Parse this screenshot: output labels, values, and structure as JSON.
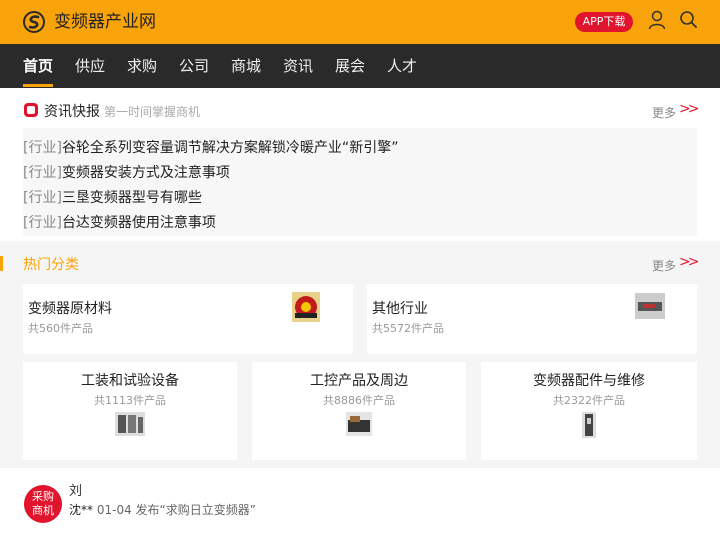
{
  "header": {
    "site_title": "变频器产业网",
    "app_button": "APP下载",
    "brand_color": "#f9a30b",
    "accent_color": "#e0142d",
    "icons": [
      "logo-icon",
      "user-icon",
      "search-icon"
    ]
  },
  "nav": {
    "items": [
      {
        "label": "首页",
        "active": true
      },
      {
        "label": "供应"
      },
      {
        "label": "求购"
      },
      {
        "label": "公司"
      },
      {
        "label": "商城"
      },
      {
        "label": "资讯"
      },
      {
        "label": "展会"
      },
      {
        "label": "人才"
      }
    ]
  },
  "news": {
    "title": "资讯快报",
    "subtitle": "第一时间掌握商机",
    "more": "更多",
    "items": [
      {
        "tag": "[行业]",
        "text": "谷轮全系列变容量调节解决方案解锁冷暖产业“新引擎”"
      },
      {
        "tag": "[行业]",
        "text": "变频器安装方式及注意事项"
      },
      {
        "tag": "[行业]",
        "text": "三垦变频器型号有哪些"
      },
      {
        "tag": "[行业]",
        "text": "台达变频器使用注意事项"
      }
    ]
  },
  "hot": {
    "title": "热门分类",
    "more": "更多",
    "categories": [
      {
        "name": "变频器原材料",
        "count": "共560件产品"
      },
      {
        "name": "其他行业",
        "count": "共5572件产品"
      },
      {
        "name": "工装和试验设备",
        "count": "共1113件产品"
      },
      {
        "name": "工控产品及周边",
        "count": "共8886件产品"
      },
      {
        "name": "变频器配件与维修",
        "count": "共2322件产品"
      }
    ]
  },
  "purchase": {
    "badge_line1": "采购",
    "badge_line2": "商机",
    "ghost_text": "刘",
    "user": "沈**",
    "time": "01-04",
    "text": "发布“求购日立变频器”"
  }
}
